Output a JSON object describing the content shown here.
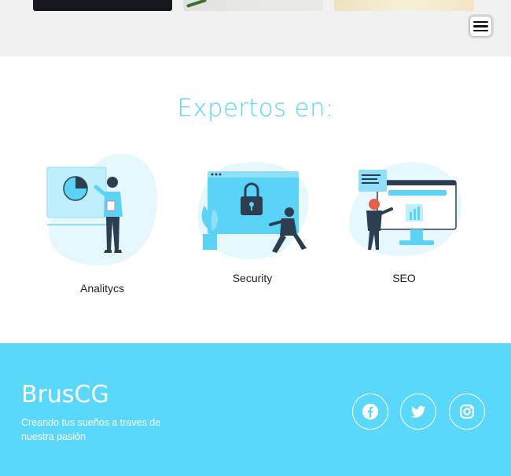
{
  "gallery": {
    "thumbnails": [
      "dark-photo",
      "leaf-photo",
      "light-photo"
    ]
  },
  "header": {
    "menu_icon": "hamburger-icon"
  },
  "experts": {
    "title": "Expertos en:",
    "items": [
      {
        "label": "Analitycs",
        "illustration": "analytics-illustration"
      },
      {
        "label": "Security",
        "illustration": "security-illustration"
      },
      {
        "label": "SEO",
        "illustration": "seo-illustration"
      }
    ]
  },
  "footer": {
    "brand": "BrusCG",
    "tagline": "Creando tus sueños a traves de nuestra pasión",
    "social": [
      {
        "name": "facebook",
        "icon": "facebook-icon"
      },
      {
        "name": "twitter",
        "icon": "twitter-icon"
      },
      {
        "name": "instagram",
        "icon": "instagram-icon"
      }
    ]
  },
  "colors": {
    "accent": "#5bd3f7",
    "footer_bg": "#5ad8fa",
    "illustration_blob": "#e6f8fe",
    "illustration_dark": "#2d3e50"
  }
}
